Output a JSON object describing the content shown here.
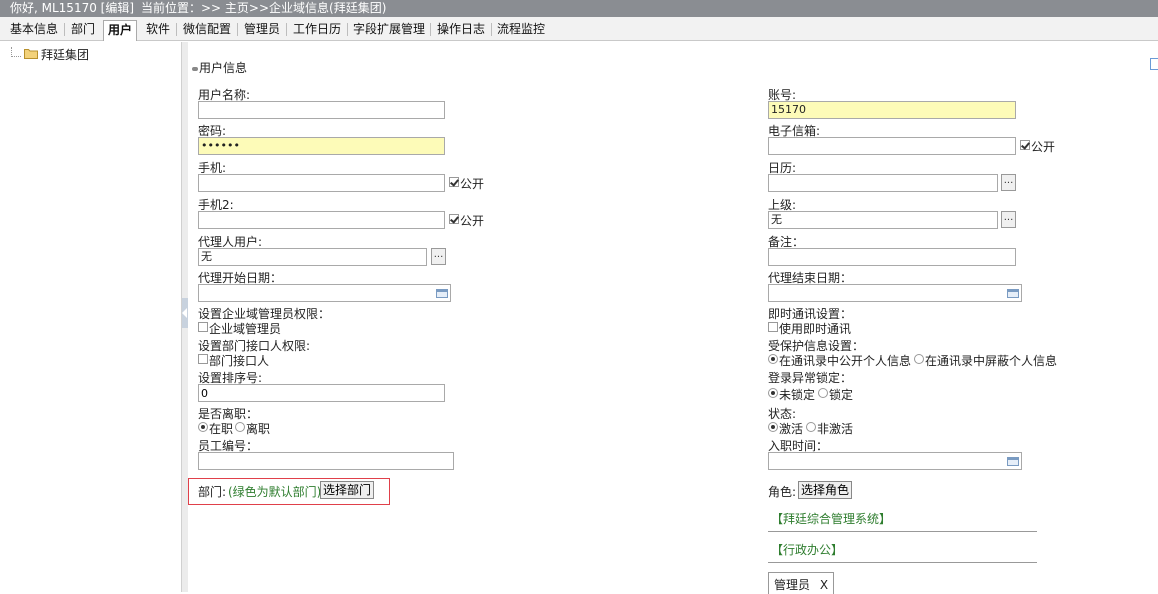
{
  "topbar": {
    "greeting": "你好, ML15170 [编辑]",
    "location": "当前位置：>> 主页>>企业域信息(拜廷集团)"
  },
  "tabs": [
    {
      "label": "基本信息",
      "active": false
    },
    {
      "label": "部门",
      "active": false
    },
    {
      "label": "用户",
      "active": true
    },
    {
      "label": "软件",
      "active": false
    },
    {
      "label": "微信配置",
      "active": false
    },
    {
      "label": "管理员",
      "active": false
    },
    {
      "label": "工作日历",
      "active": false
    },
    {
      "label": "字段扩展管理",
      "active": false
    },
    {
      "label": "操作日志",
      "active": false
    },
    {
      "label": "流程监控",
      "active": false
    }
  ],
  "tree": {
    "root_label": "拜廷集团"
  },
  "section": {
    "title": "用户信息"
  },
  "form": {
    "username_label": "用户名称:",
    "username_value": "",
    "account_label": "账号:",
    "account_value": "15170",
    "password_label": "密码:",
    "password_value": "••••••",
    "email_label": "电子信箱:",
    "email_value": "",
    "email_public_label": "公开",
    "mobile_label": "手机:",
    "mobile_value": "",
    "mobile_public_label": "公开",
    "calendar_label": "日历:",
    "calendar_value": "",
    "mobile2_label": "手机2:",
    "mobile2_value": "",
    "mobile2_public_label": "公开",
    "superior_label": "上级:",
    "superior_value": "无",
    "agent_label": "代理人用户:",
    "agent_value": "无",
    "remark_label": "备注：",
    "remark_value": "",
    "agent_start_label": "代理开始日期：",
    "agent_start_value": "",
    "agent_end_label": "代理结束日期：",
    "agent_end_value": "",
    "admin_perm_label": "设置企业域管理员权限：",
    "admin_perm_option": "企业域管理员",
    "im_label": "即时通讯设置：",
    "im_option": "使用即时通讯",
    "dept_iface_label": "设置部门接口人权限:",
    "dept_iface_option": "部门接口人",
    "privacy_label": "受保护信息设置：",
    "privacy_opt1": "在通讯录中公开个人信息",
    "privacy_opt2": "在通讯录中屏蔽个人信息",
    "sort_label": "设置排序号:",
    "sort_value": "0",
    "lock_label": "登录异常锁定：",
    "lock_opt1": "未锁定",
    "lock_opt2": "锁定",
    "leave_label": "是否离职：",
    "leave_opt1": "在职",
    "leave_opt2": "离职",
    "status_label": "状态:",
    "status_opt1": "激活",
    "status_opt2": "非激活",
    "empno_label": "员工编号：",
    "empno_value": "",
    "hire_label": "入职时间：",
    "hire_value": "",
    "dept_label": "部门:",
    "dept_hint": "(绿色为默认部门)",
    "dept_button": "选择部门",
    "role_label": "角色:",
    "role_button": "选择角色",
    "dots": "..."
  },
  "roles": {
    "system1": "【拜廷综合管理系统】",
    "system2": "【行政办公】",
    "role_tag": "管理员",
    "role_remove": "X"
  }
}
